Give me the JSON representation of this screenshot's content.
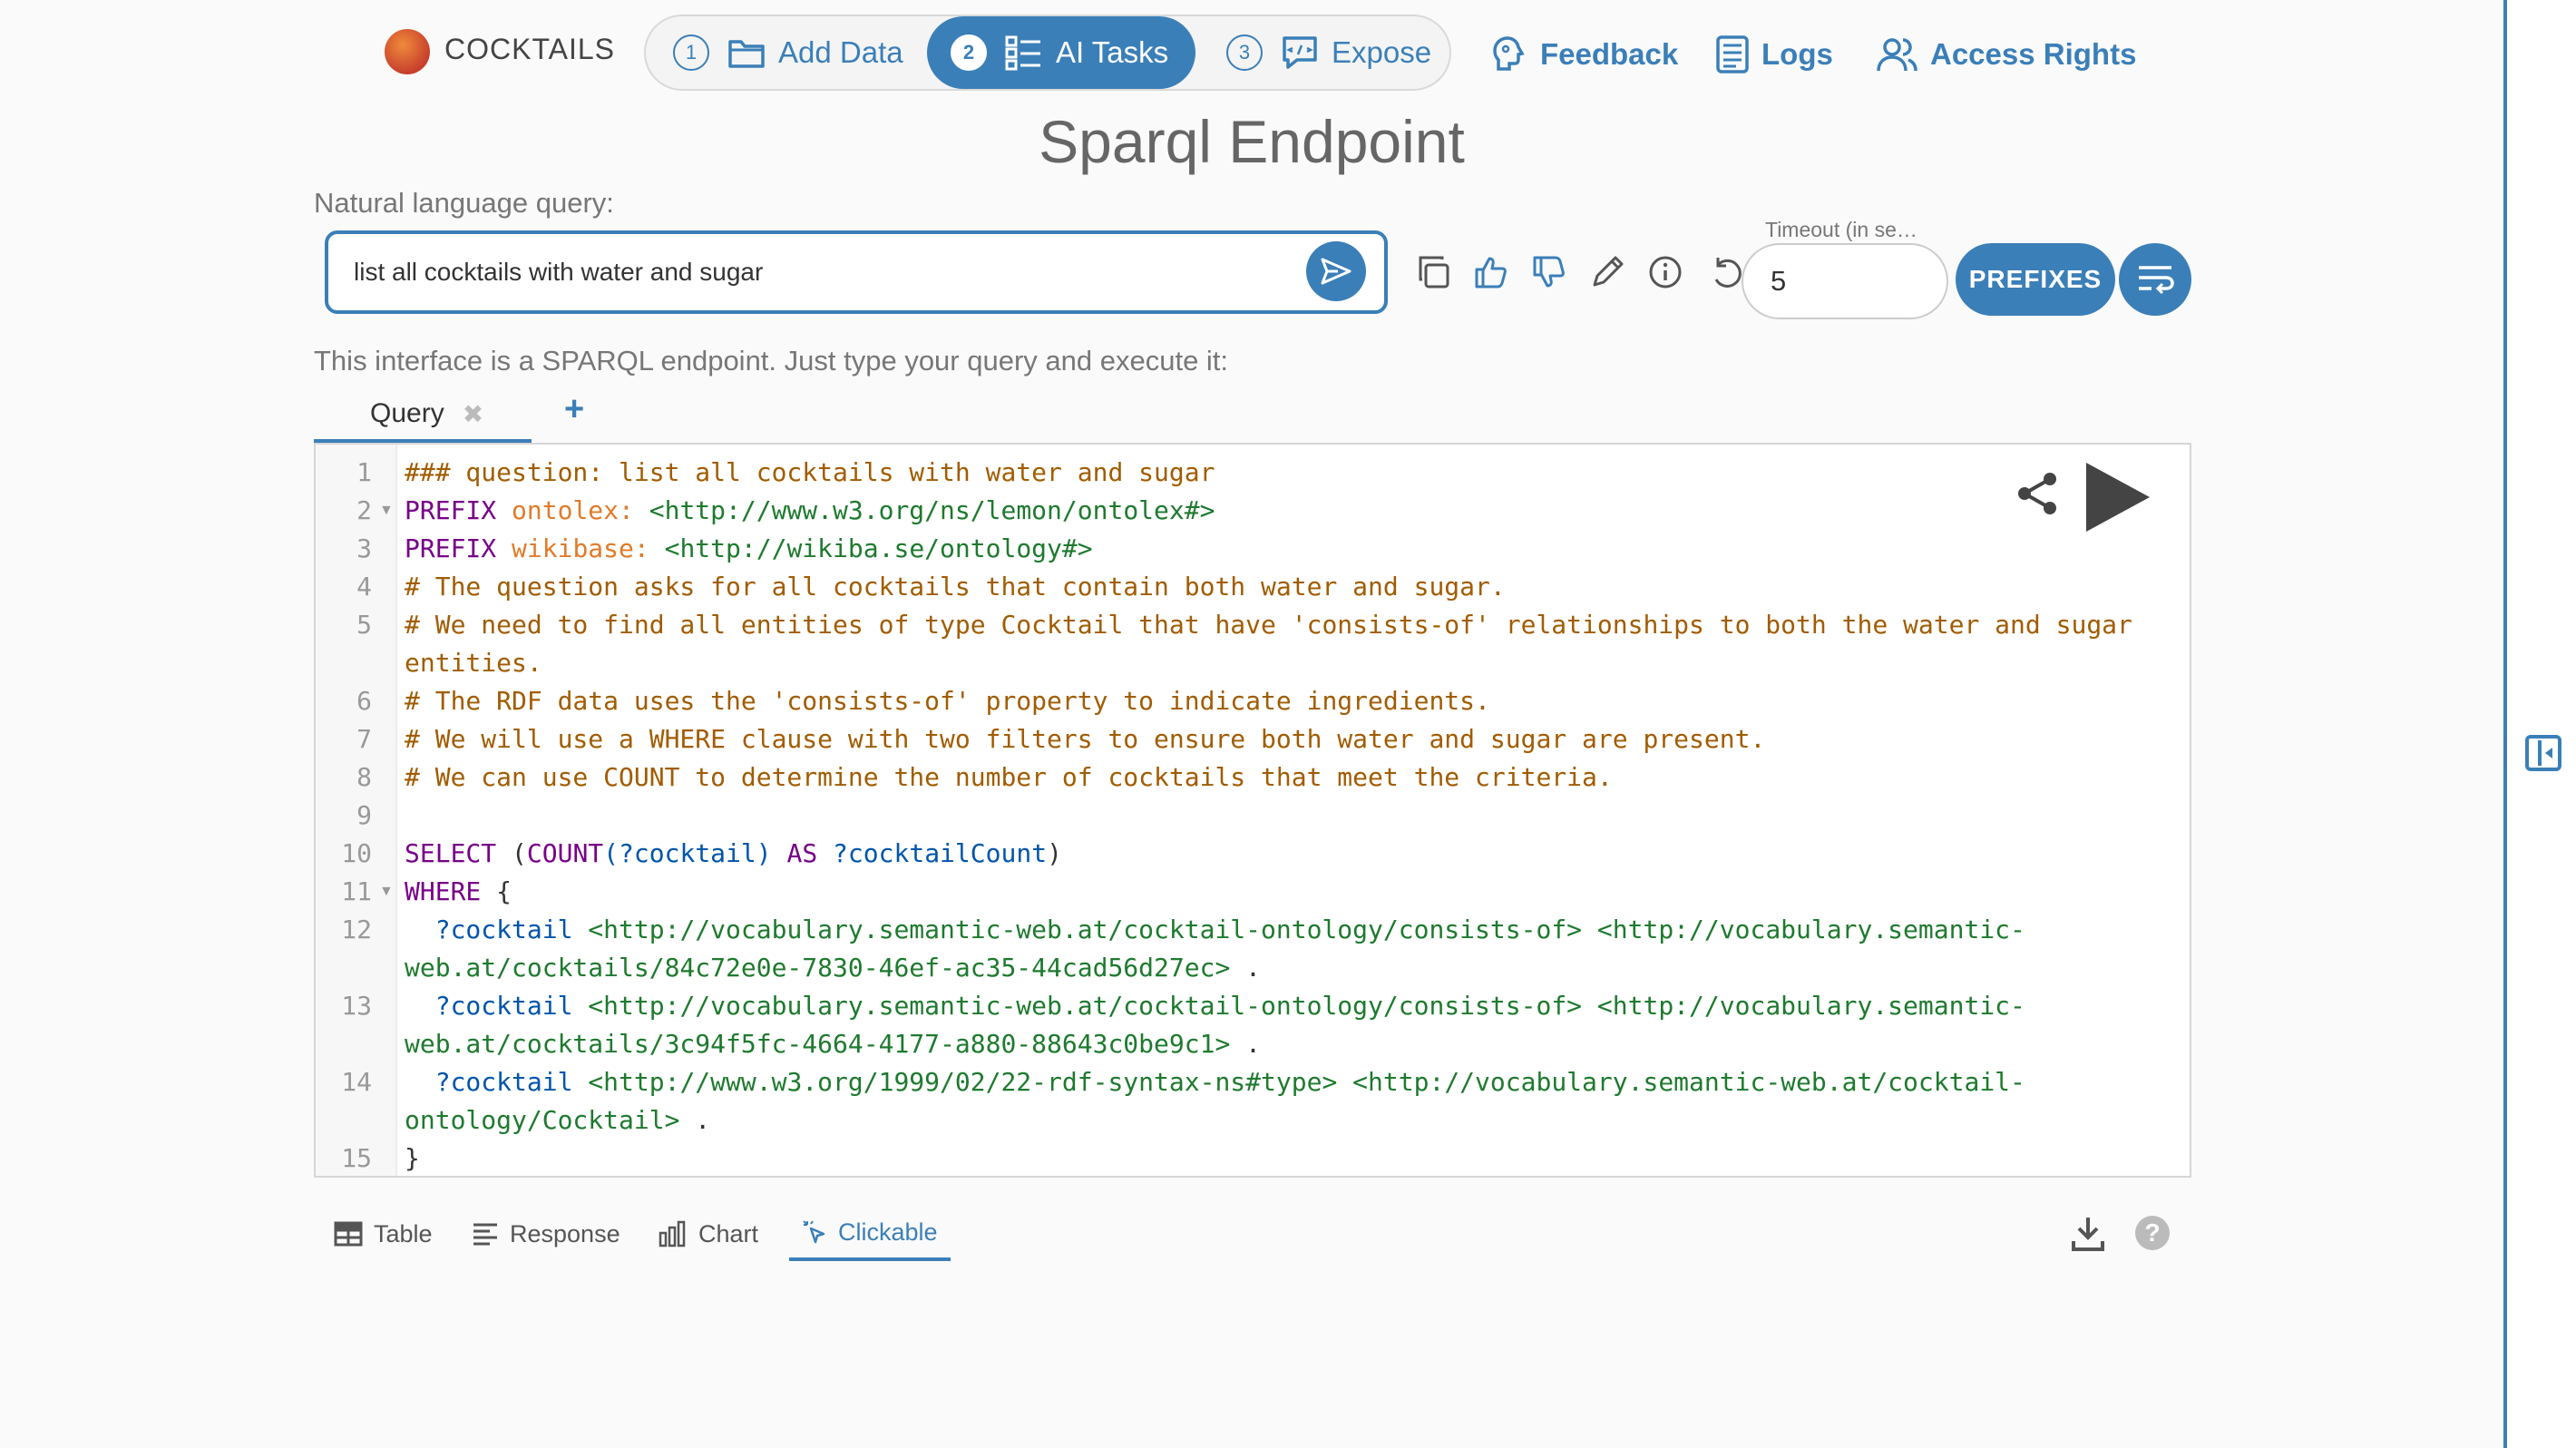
{
  "brand": {
    "name": "COCKTAILS"
  },
  "steps": [
    {
      "num": "1",
      "label": "Add Data"
    },
    {
      "num": "2",
      "label": "AI Tasks"
    },
    {
      "num": "3",
      "label": "Expose"
    }
  ],
  "nav": {
    "feedback": "Feedback",
    "logs": "Logs",
    "access_rights": "Access Rights"
  },
  "page": {
    "title": "Sparql Endpoint",
    "nl_label": "Natural language query:",
    "nl_value": "list all cocktails with water and sugar",
    "intro": "This interface is a SPARQL endpoint. Just type your query and execute it:"
  },
  "timeout": {
    "label": "Timeout (in se…",
    "value": "5"
  },
  "buttons": {
    "prefixes": "PREFIXES"
  },
  "tabs": {
    "query": "Query",
    "close": "✖",
    "add": "+"
  },
  "editor": {
    "line_numbers": [
      "1",
      "2",
      "3",
      "4",
      "5",
      "6",
      "7",
      "8",
      "9",
      "10",
      "11",
      "12",
      "13",
      "14",
      "15"
    ],
    "lines": {
      "l1": "### question: list all cocktails with water and sugar",
      "l2_kw": "PREFIX",
      "l2_prefix": "ontolex:",
      "l2_iri": "<http://www.w3.org/ns/lemon/ontolex#>",
      "l3_kw": "PREFIX",
      "l3_prefix": "wikibase:",
      "l3_iri": "<http://wikiba.se/ontology#>",
      "l4": "# The question asks for all cocktails that contain both water and sugar.",
      "l5a": "# We need to find all entities of type Cocktail that have 'consists-of' relationships to both the water and sugar",
      "l5b": "entities.",
      "l6": "# The RDF data uses the 'consists-of' property to indicate ingredients.",
      "l7": "# We will use a WHERE clause with two filters to ensure both water and sugar are present.",
      "l8": "# We can use COUNT to determine the number of cocktails that meet the criteria.",
      "l10_kw": "SELECT",
      "l10_open": " (",
      "l10_fn": "COUNT",
      "l10_var1": "(?cocktail)",
      "l10_as": " AS ",
      "l10_var2": "?cocktailCount",
      "l10_close": ")",
      "l11_kw": "WHERE",
      "l11_brace": " {",
      "l12_var": "  ?cocktail",
      "l12_iri1": " <http://vocabulary.semantic-web.at/cocktail-ontology/consists-of>",
      "l12_iri2a": " <http://vocabulary.semantic-",
      "l12_iri2b": "web.at/cocktails/84c72e0e-7830-46ef-ac35-44cad56d27ec>",
      "l12_end": " .",
      "l13_var": "  ?cocktail",
      "l13_iri1": " <http://vocabulary.semantic-web.at/cocktail-ontology/consists-of>",
      "l13_iri2a": " <http://vocabulary.semantic-",
      "l13_iri2b": "web.at/cocktails/3c94f5fc-4664-4177-a880-88643c0be9c1>",
      "l13_end": " .",
      "l14_var": "  ?cocktail",
      "l14_iri1": " <http://www.w3.org/1999/02/22-rdf-syntax-ns#type>",
      "l14_iri2a": " <http://vocabulary.semantic-web.at/cocktail-",
      "l14_iri2b": "ontology/Cocktail>",
      "l14_end": " .",
      "l15": "}"
    }
  },
  "result_tabs": [
    {
      "label": "Table"
    },
    {
      "label": "Response"
    },
    {
      "label": "Chart"
    },
    {
      "label": "Clickable"
    }
  ],
  "colors": {
    "accent": "#3b7fb8",
    "comment": "#a15c00",
    "keyword": "#770088",
    "prefix": "#e07b2a",
    "iri": "#1e7a2e",
    "variable": "#0055aa"
  }
}
